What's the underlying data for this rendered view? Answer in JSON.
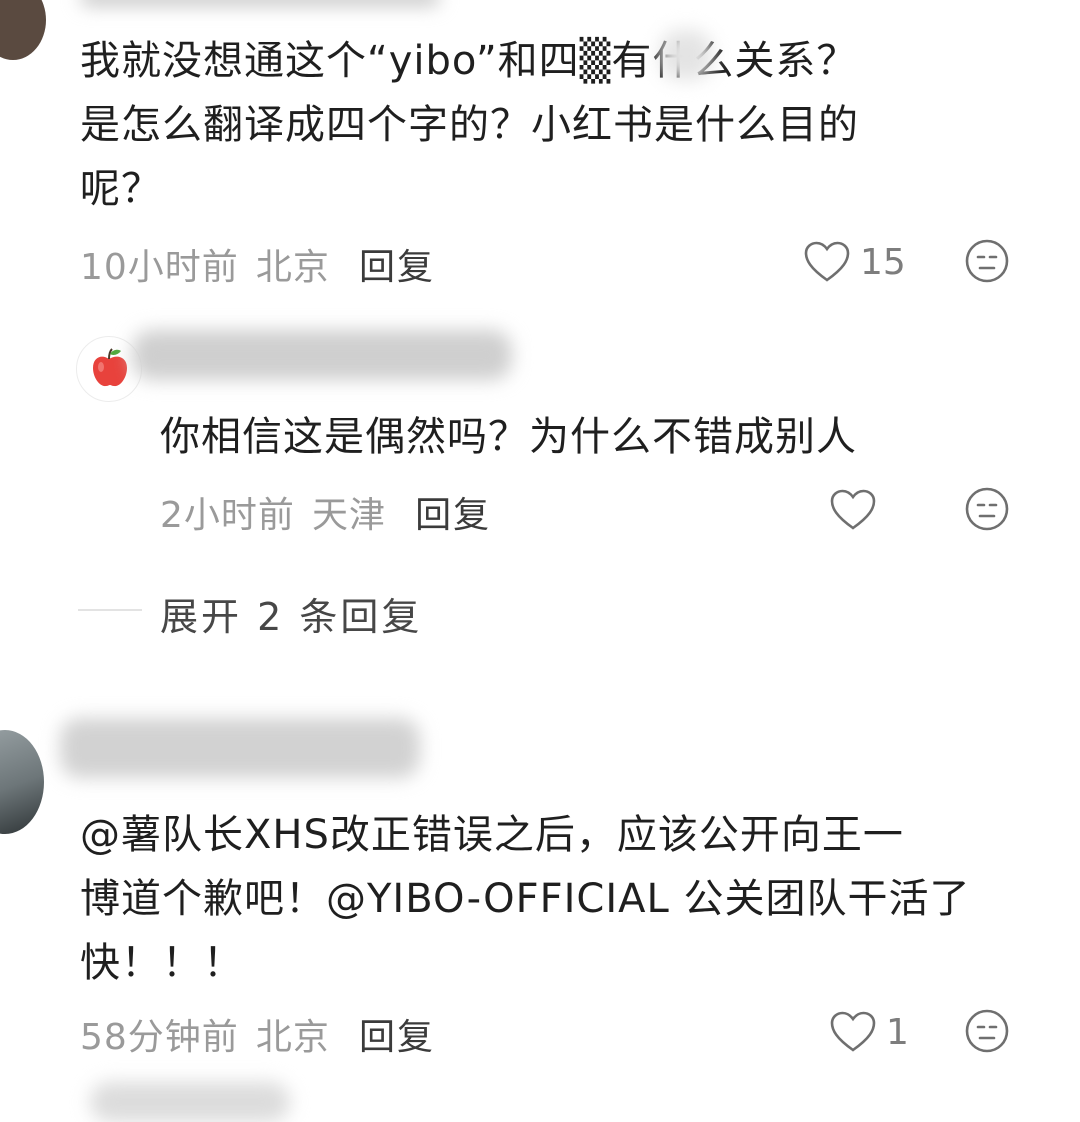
{
  "comments": [
    {
      "text_lines": [
        "我就没想通这个“yibo”和四▒有什么关系？",
        "是怎么翻译成四个字的？小红书是什么目的",
        "呢？"
      ],
      "time": "10小时前",
      "location": "北京",
      "reply_label": "回复",
      "likes": "15"
    },
    {
      "text_lines": [
        "你相信这是偶然吗？为什么不错成别人"
      ],
      "time": "2小时前",
      "location": "天津",
      "reply_label": "回复",
      "likes": ""
    },
    {
      "text_lines": [
        "@薯队长XHS改正错误之后，应该公开向王一",
        "博道个歉吧！@YIBO-OFFICIAL 公关团队干活了",
        "快！！！"
      ],
      "time": "58分钟前",
      "location": "北京",
      "reply_label": "回复",
      "likes": "1"
    }
  ],
  "expand_replies": "展开 2 条回复",
  "icons": [
    "heart-icon",
    "neutral-face-icon",
    "apple-avatar-icon"
  ],
  "colors": {
    "meta_gray": "#9a9a9a",
    "text": "#1f1f1f",
    "reply": "#3b3b3b",
    "apple_red": "#e8423c"
  }
}
